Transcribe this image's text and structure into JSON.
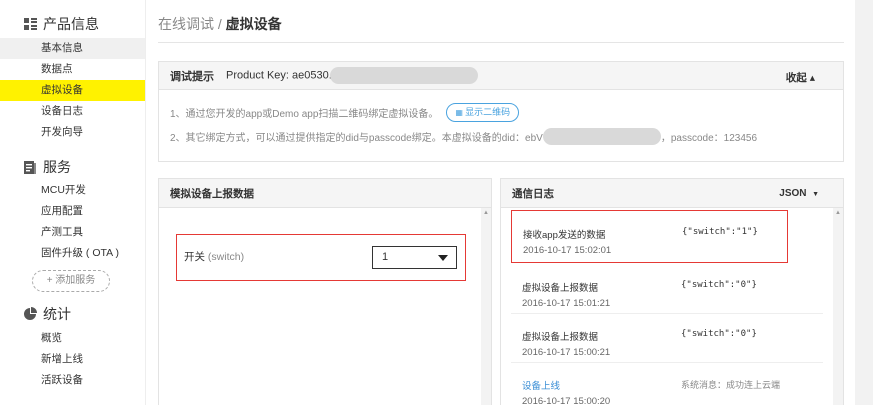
{
  "sidebar": {
    "product": {
      "title": "产品信息",
      "items": [
        "基本信息",
        "数据点",
        "虚拟设备",
        "设备日志",
        "开发向导"
      ]
    },
    "service": {
      "title": "服务",
      "items": [
        "MCU开发",
        "应用配置",
        "产测工具",
        "固件升级 ( OTA )"
      ],
      "add_label": "+ 添加服务"
    },
    "stats": {
      "title": "统计",
      "items": [
        "概览",
        "新增上线",
        "活跃设备"
      ]
    }
  },
  "breadcrumb": {
    "parent": "在线调试 / ",
    "current": "虚拟设备"
  },
  "tip": {
    "title": "调试提示",
    "product_key_prefix": "Product Key: ae0530.",
    "collapse_label": "收起 ▴",
    "line1": "1、通过您开发的app或Demo app扫描二维码绑定虚拟设备。",
    "qr_button": "显示二维码",
    "line2_prefix": "2、其它绑定方式，可以通过提供指定的did与passcode绑定。本虚拟设备的did：ebV",
    "line2_suffix": "，passcode：123456"
  },
  "simulate": {
    "title": "模拟设备上报数据",
    "field_name": "开关 ",
    "field_key": "(switch)",
    "field_value": "1"
  },
  "comm_log": {
    "title": "通信日志",
    "format": "JSON",
    "entries": [
      {
        "type": "接收app发送的数据",
        "time": "2016-10-17 15:02:01",
        "payload": "{\"switch\":\"1\"}"
      },
      {
        "type": "虚拟设备上报数据",
        "time": "2016-10-17 15:01:21",
        "payload": "{\"switch\":\"0\"}"
      },
      {
        "type": "虚拟设备上报数据",
        "time": "2016-10-17 15:00:21",
        "payload": "{\"switch\":\"0\"}"
      },
      {
        "type": "设备上线",
        "time": "2016-10-17 15:00:20",
        "payload": "系统消息：成功连上云端"
      }
    ]
  }
}
